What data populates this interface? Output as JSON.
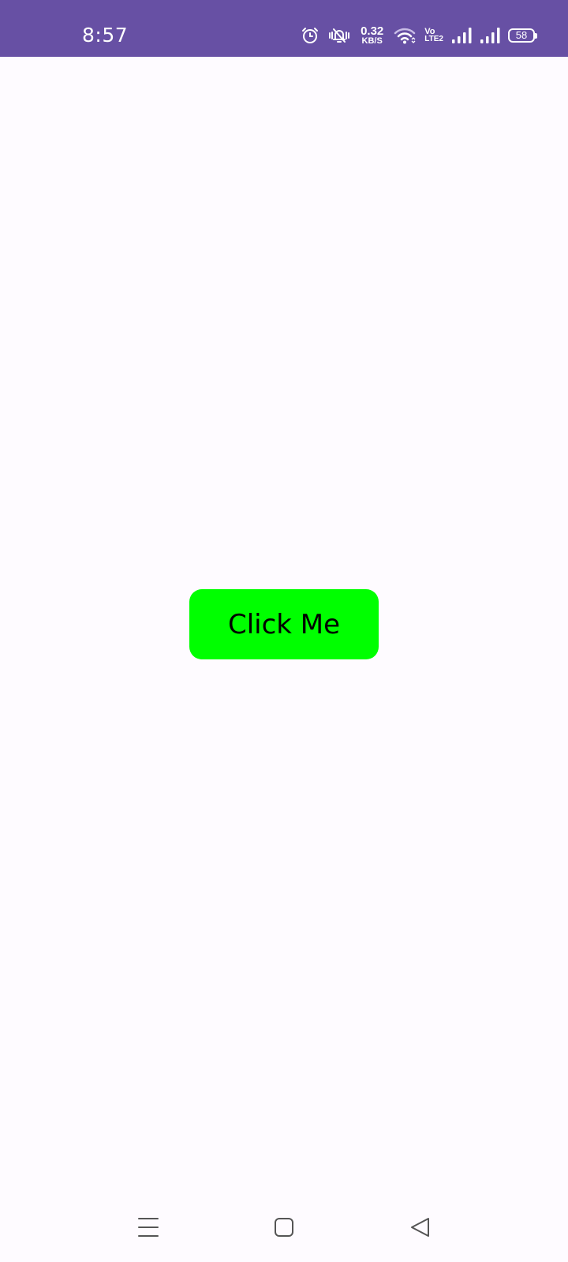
{
  "status_bar": {
    "time": "8:57",
    "net_speed_value": "0.32",
    "net_speed_unit": "KB/S",
    "volte_top": "Vo",
    "volte_bottom": "LTE2",
    "battery_level": "58",
    "background_color": "#6750a4",
    "icons": [
      "alarm-icon",
      "vibrate-icon",
      "wifi-icon",
      "signal-icon",
      "signal-icon",
      "battery-icon"
    ]
  },
  "main": {
    "button_label": "Click Me",
    "button_color": "#00ff00",
    "background_color": "#fefbff"
  },
  "nav_bar": {
    "icons": [
      "menu-icon",
      "home-icon",
      "back-icon"
    ]
  }
}
